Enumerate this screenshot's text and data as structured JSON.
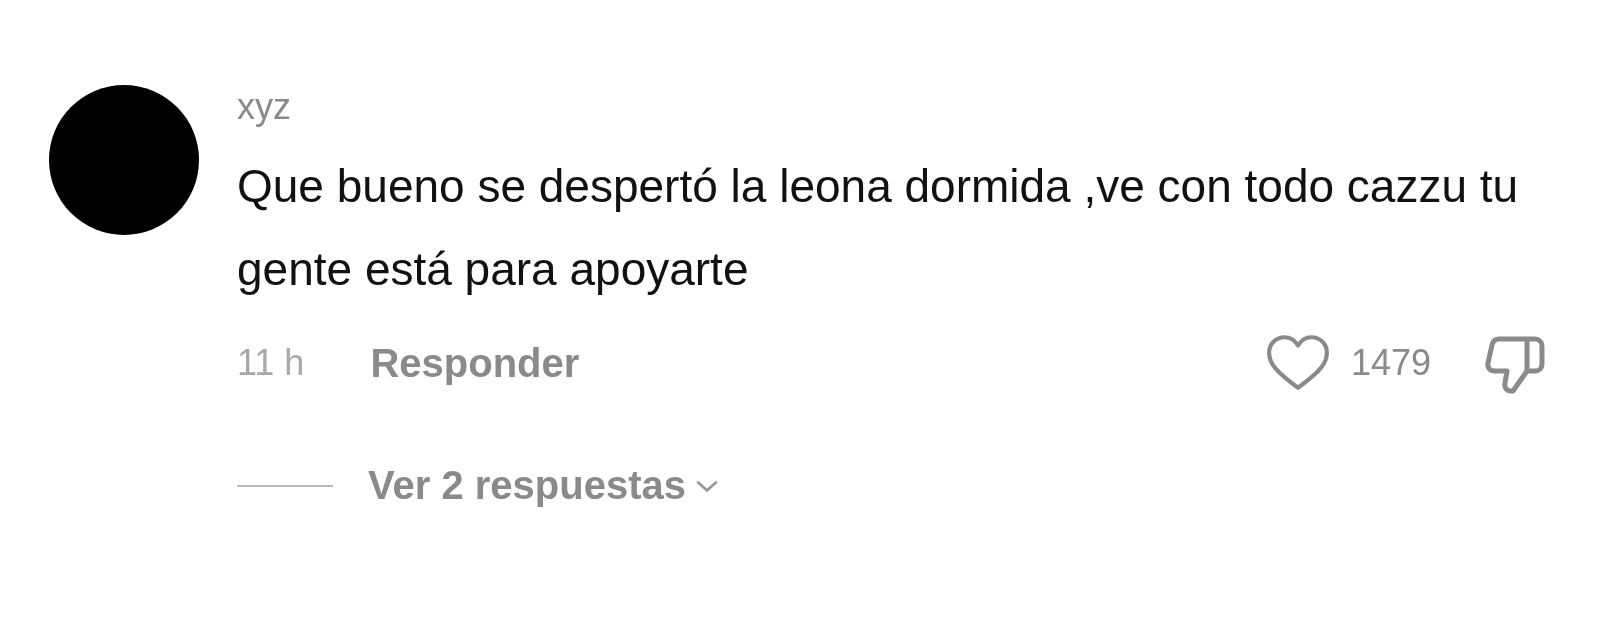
{
  "comment": {
    "username": "xyz",
    "text": "Que bueno se despertó la leona dormida ,ve con todo cazzu tu gente está para apoyarte",
    "time": "11 h",
    "reply": "Responder",
    "likes": "1479",
    "liked": false,
    "replies": {
      "label": "Ver 2 respuestas",
      "expanded": false
    }
  }
}
